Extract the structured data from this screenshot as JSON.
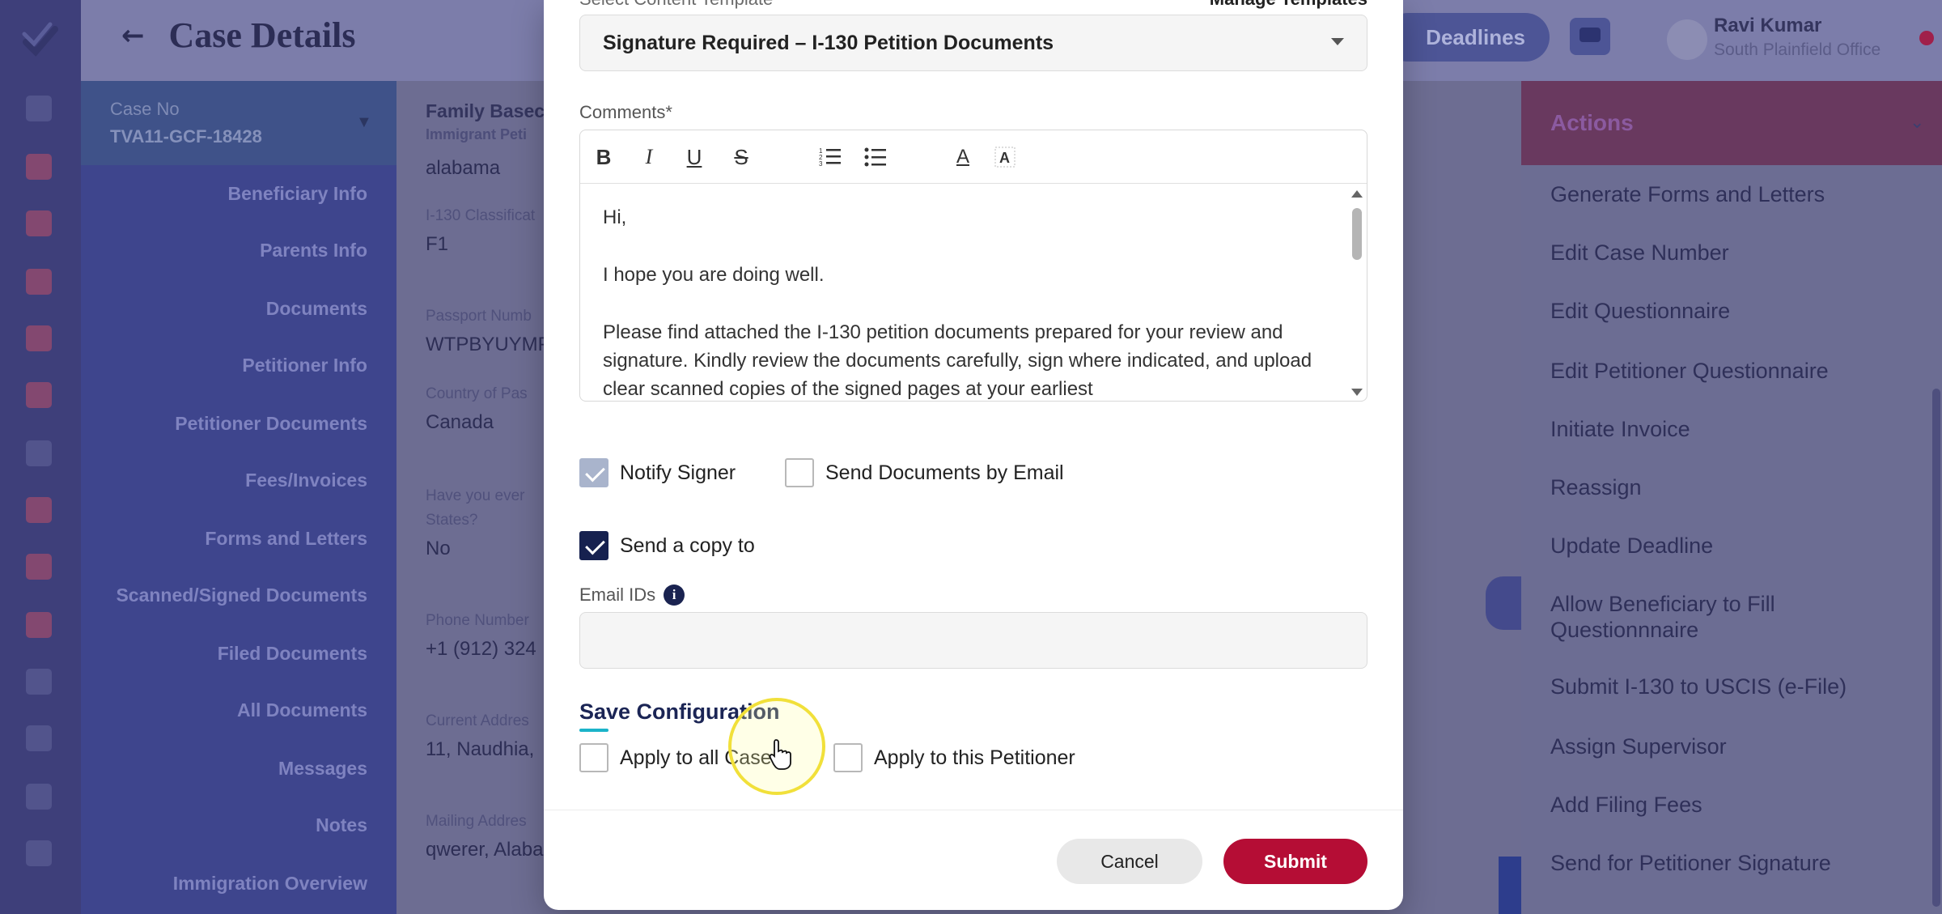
{
  "app": {
    "page_title": "Case Details",
    "back_label": "←"
  },
  "header": {
    "deadlines_label": "Deadlines",
    "user_name": "Ravi Kumar",
    "user_office": "South Plainfield Office"
  },
  "case": {
    "label": "Case No",
    "value": "TVA11-GCF-18428",
    "family_title": "Family Basec",
    "family_sub": "Immigrant Peti"
  },
  "sidebar": {
    "items": [
      {
        "label": "Beneficiary Info"
      },
      {
        "label": "Parents Info"
      },
      {
        "label": "Documents"
      },
      {
        "label": "Petitioner Info"
      },
      {
        "label": "Petitioner Documents"
      },
      {
        "label": "Fees/Invoices"
      },
      {
        "label": "Forms and Letters"
      },
      {
        "label": "Scanned/Signed Documents"
      },
      {
        "label": "Filed Documents"
      },
      {
        "label": "All Documents"
      },
      {
        "label": "Messages"
      },
      {
        "label": "Notes"
      },
      {
        "label": "Immigration Overview"
      }
    ]
  },
  "fields": [
    {
      "label": "",
      "value": "alabama"
    },
    {
      "label": "I-130 Classificat",
      "value": "F1"
    },
    {
      "label": "Passport Numb",
      "value": "WTPBYUYMP"
    },
    {
      "label": "Country of Pas",
      "value": "Canada"
    },
    {
      "label": "Have you ever",
      "label2": "States?",
      "value": "No"
    },
    {
      "label": "Phone Number",
      "value": "+1 (912) 324"
    },
    {
      "label": "Current Addres",
      "value": "11, Naudhia,"
    },
    {
      "label": "Mailing Addres",
      "value": "qwerer, Alaba"
    }
  ],
  "actions": {
    "title": "Actions",
    "items": [
      {
        "label": "Generate Forms and Letters"
      },
      {
        "label": "Edit Case Number"
      },
      {
        "label": "Edit Questionnaire"
      },
      {
        "label": "Edit Petitioner Questionnaire"
      },
      {
        "label": "Initiate Invoice"
      },
      {
        "label": "Reassign"
      },
      {
        "label": "Update Deadline"
      },
      {
        "label": "Allow Beneficiary to Fill Questionnnaire"
      },
      {
        "label": "Submit I-130 to USCIS (e-File)"
      },
      {
        "label": "Assign Supervisor"
      },
      {
        "label": "Add Filing Fees"
      },
      {
        "label": "Send for Petitioner Signature"
      }
    ]
  },
  "modal": {
    "template_label": "Select Content Template",
    "manage_templates": "Manage Templates",
    "template_value": "Signature Required – I-130 Petition Documents",
    "comments_label": "Comments*",
    "toolbar": {
      "bold": "B",
      "italic": "I",
      "underline": "U",
      "strike": "S",
      "ordered_list": "ordered-list-icon",
      "bullet_list": "bullet-list-icon",
      "font_color": "A",
      "clear_format": "clear-format-icon"
    },
    "body": {
      "p1": "Hi,",
      "p2": "I hope you are doing well.",
      "p3": "Please find attached the I-130 petition documents prepared for your review and signature. Kindly review the documents carefully, sign where indicated, and upload clear scanned copies of the signed pages at your earliest"
    },
    "notify_signer_label": "Notify Signer",
    "notify_signer_checked": true,
    "send_docs_email_label": "Send Documents by Email",
    "send_docs_email_checked": false,
    "send_copy_label": "Send a copy to",
    "send_copy_checked": true,
    "email_ids_label": "Email IDs",
    "email_ids_value": "",
    "save_config_title": "Save Configuration",
    "apply_all_cases_label": "Apply to all Cases",
    "apply_all_cases_checked": false,
    "apply_petitioner_label": "Apply to this Petitioner",
    "apply_petitioner_checked": false,
    "cancel_label": "Cancel",
    "submit_label": "Submit"
  },
  "colors": {
    "primary_dark": "#16214f",
    "submit": "#b50d35",
    "accent_underline": "#1bb3c9",
    "cursor_halo": "#f1e03a"
  }
}
